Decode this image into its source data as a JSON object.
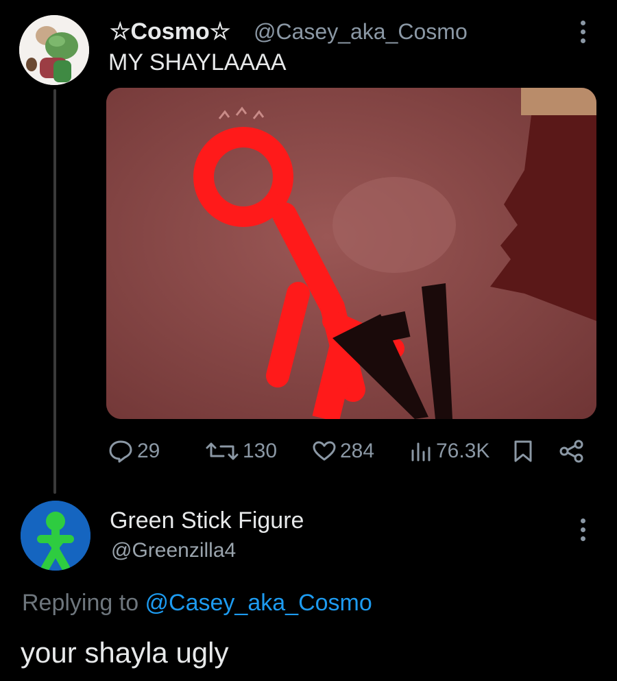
{
  "tweet": {
    "author_name": "☆Cosmo☆",
    "author_handle": "@Casey_aka_Cosmo",
    "text": "MY SHAYLAAAA",
    "media_description_icon": "video-thumbnail",
    "stats": {
      "replies": "29",
      "retweets": "130",
      "likes": "284",
      "views": "76.3K"
    }
  },
  "reply": {
    "author_name": "Green Stick Figure",
    "author_handle": "@Greenzilla4",
    "replying_prefix": "Replying to ",
    "replying_handle": "@Casey_aka_Cosmo",
    "text": "your shayla ugly"
  },
  "colors": {
    "background": "#000000",
    "text": "#e7e9ea",
    "muted": "#8b98a5",
    "link": "#1d9bf0",
    "avatar2_bg": "#1565c0",
    "stick_green": "#2ecc40"
  }
}
